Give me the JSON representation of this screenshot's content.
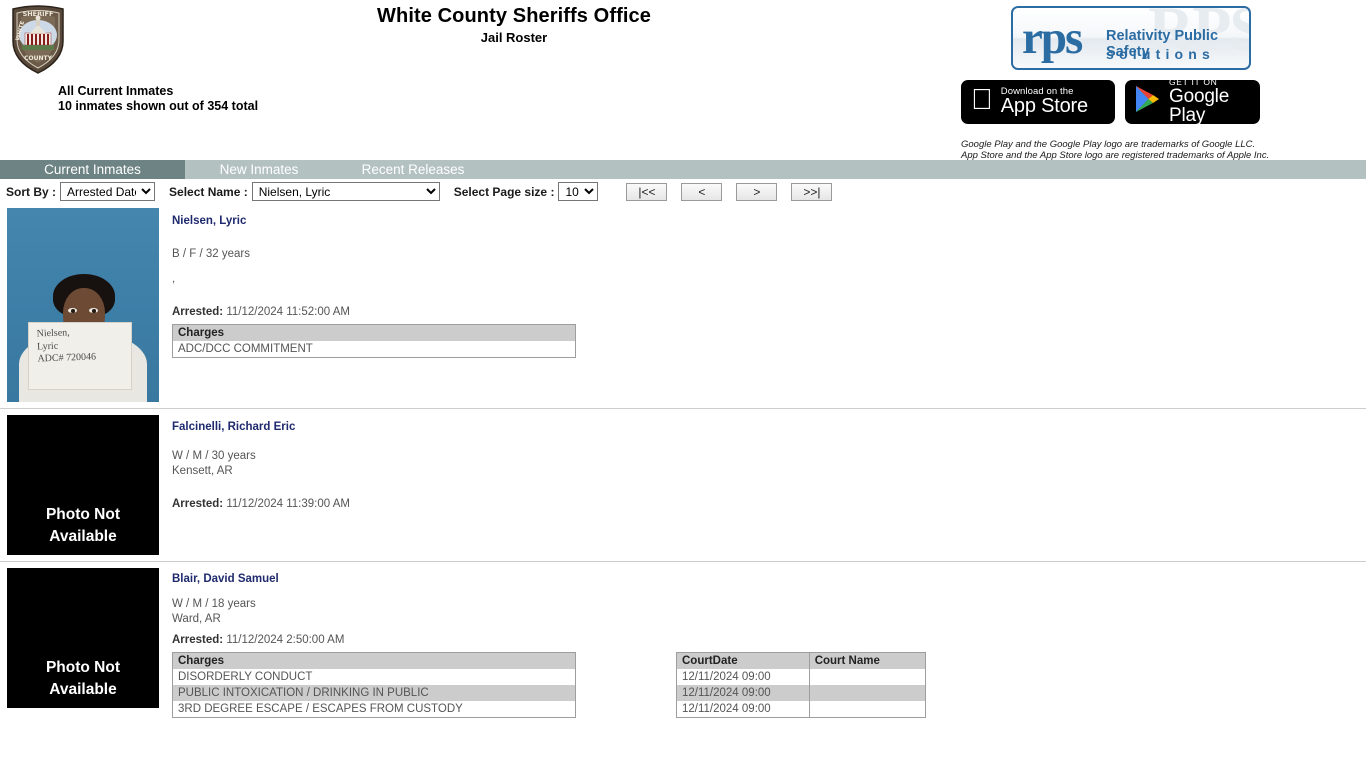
{
  "header": {
    "title": "White County Sheriffs Office",
    "subtitle": "Jail Roster",
    "summary_line1": "All Current Inmates",
    "summary_line2": "10 inmates shown out of 354 total",
    "badge_icon": "sheriff-badge-icon"
  },
  "branding": {
    "rps_mark": "rps",
    "rps_line1": "Relativity Public Safety",
    "rps_line2": "solutions",
    "rps_ghost": "RPS",
    "rps_color": "#2b6ca3",
    "appstore": {
      "small": "Download on the",
      "big": "App Store",
      "icon": "apple-logo-icon"
    },
    "googleplay": {
      "small": "GET IT ON",
      "big": "Google Play",
      "icon": "google-play-logo-icon"
    },
    "trademark_line1": "Google Play and the Google Play logo are trademarks of Google LLC.",
    "trademark_line2": "App Store and the App Store logo are registered trademarks of Apple Inc."
  },
  "tabs": [
    {
      "label": "Current Inmates",
      "active": true
    },
    {
      "label": "New Inmates",
      "active": false
    },
    {
      "label": "Recent Releases",
      "active": false
    }
  ],
  "toolbar": {
    "sort_label": "Sort By :",
    "sort_value": "Arrested Date",
    "sort_options": [
      "Arrested Date"
    ],
    "name_label": "Select Name :",
    "name_value": "Nielsen, Lyric",
    "name_options": [
      "Nielsen, Lyric"
    ],
    "pagesize_label": "Select Page size :",
    "pagesize_value": "10",
    "pagesize_options": [
      "10"
    ],
    "btn_first": "|<<",
    "btn_prev": "<",
    "btn_next": ">",
    "btn_last": ">>|"
  },
  "photo_placeholder": {
    "line1": "Photo Not",
    "line2": "Available"
  },
  "mugshot_sign_text": "Nielsen,\nLyric\nADC# 720046",
  "table_headers": {
    "charges": "Charges",
    "court_date": "CourtDate",
    "court_name": "Court Name"
  },
  "arrested_label": "Arrested:",
  "inmates": [
    {
      "name": "Nielsen, Lyric",
      "demographics": "B / F / 32 years",
      "address": ",",
      "arrested": "11/12/2024 11:52:00 AM",
      "has_photo": true,
      "charges": [
        "ADC/DCC COMMITMENT"
      ],
      "court_dates": []
    },
    {
      "name": "Falcinelli, Richard Eric",
      "demographics": "W / M / 30 years",
      "address": "Kensett, AR",
      "arrested": "11/12/2024 11:39:00 AM",
      "has_photo": false,
      "charges": [],
      "court_dates": []
    },
    {
      "name": "Blair, David Samuel",
      "demographics": "W / M / 18 years",
      "address": "Ward, AR",
      "arrested": "11/12/2024 2:50:00 AM",
      "has_photo": false,
      "charges": [
        "DISORDERLY CONDUCT",
        "PUBLIC INTOXICATION / DRINKING IN PUBLIC",
        "3RD DEGREE ESCAPE / ESCAPES FROM CUSTODY"
      ],
      "court_dates": [
        {
          "date": "12/11/2024 09:00",
          "name": ""
        },
        {
          "date": "12/11/2024 09:00",
          "name": ""
        },
        {
          "date": "12/11/2024 09:00",
          "name": ""
        }
      ]
    }
  ]
}
